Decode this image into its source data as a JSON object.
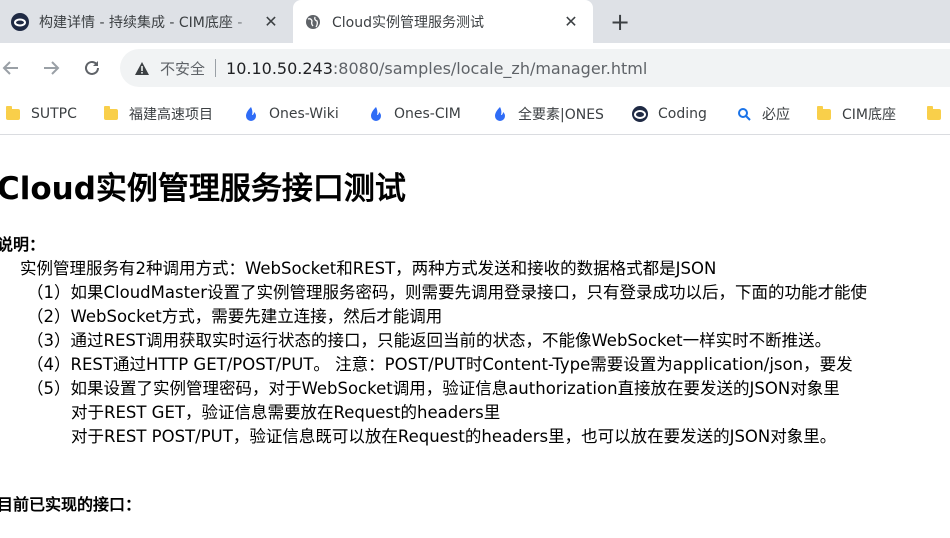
{
  "tabs": [
    {
      "title": "构建详情 - 持续集成 - CIM底座 -",
      "favicon": "coding-logo-icon",
      "active": false
    },
    {
      "title": "Cloud实例管理服务测试",
      "favicon": "globe-icon",
      "active": true
    }
  ],
  "toolbar": {
    "insecure_label": "不安全",
    "url_host": "10.10.50.243",
    "url_rest": ":8080/samples/locale_zh/manager.html"
  },
  "bookmarks": [
    {
      "label": "SUTPC",
      "icon": "folder-icon"
    },
    {
      "label": "福建高速项目",
      "icon": "folder-icon"
    },
    {
      "label": "Ones-Wiki",
      "icon": "ones-icon"
    },
    {
      "label": "Ones-CIM",
      "icon": "ones-icon"
    },
    {
      "label": "全要素|ONES",
      "icon": "ones-icon"
    },
    {
      "label": "Coding",
      "icon": "coding-logo-icon"
    },
    {
      "label": "必应",
      "icon": "search-icon"
    },
    {
      "label": "CIM底座",
      "icon": "folder-icon"
    }
  ],
  "content": {
    "heading": "Cloud实例管理服务接口测试",
    "desc_label": "说明：",
    "lines": [
      "实例管理服务有2种调用方式：WebSocket和REST，两种方式发送和接收的数据格式都是JSON",
      "（1）如果CloudMaster设置了实例管理服务密码，则需要先调用登录接口，只有登录成功以后，下面的功能才能使",
      "（2）WebSocket方式，需要先建立连接，然后才能调用",
      "（3）通过REST调用获取实时运行状态的接口，只能返回当前的状态，不能像WebSocket一样实时不断推送。",
      "（4）REST通过HTTP GET/POST/PUT。 注意：POST/PUT时Content-Type需要设置为application/json，要发",
      "（5）如果设置了实例管理密码，对于WebSocket调用，验证信息authorization直接放在要发送的JSON对象里",
      "对于REST GET，验证信息需要放在Request的headers里",
      "对于REST POST/PUT，验证信息既可以放在Request的headers里，也可以放在要发送的JSON对象里。"
    ],
    "implemented_label": "目前已实现的接口："
  }
}
